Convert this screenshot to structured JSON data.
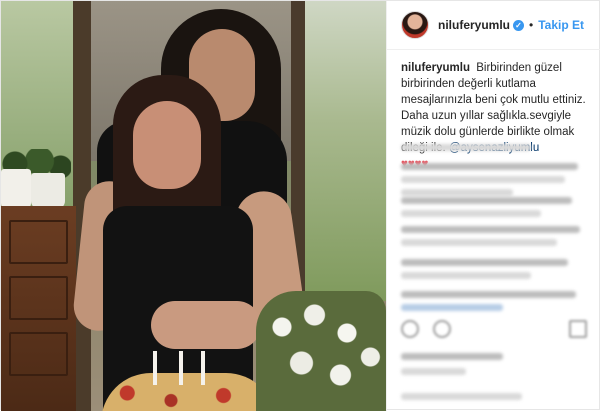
{
  "header": {
    "username": "niluferyumlu",
    "verified_glyph": "✓",
    "separator": "•",
    "follow_label": "Takip Et"
  },
  "caption": {
    "username": "niluferyumlu",
    "text": "Birbirinden güzel birbirinden değerli kutlama mesajlarınızla beni çok mutlu ettiniz. Daha uzun yıllar sağlıkla.sevgiyle müzik dolu günlerde birlikte olmak dileği ile.",
    "mention": "@aysenazliyumlu",
    "hearts": "♥♥♥♥"
  },
  "icons": {
    "avatar": "profile-avatar",
    "verified": "verified-badge-icon",
    "like": "heart-icon",
    "comment": "comment-icon",
    "save": "bookmark-icon"
  },
  "colors": {
    "accent": "#3897f0",
    "text": "#262626",
    "heart": "#ed4956",
    "mention": "#003569"
  }
}
